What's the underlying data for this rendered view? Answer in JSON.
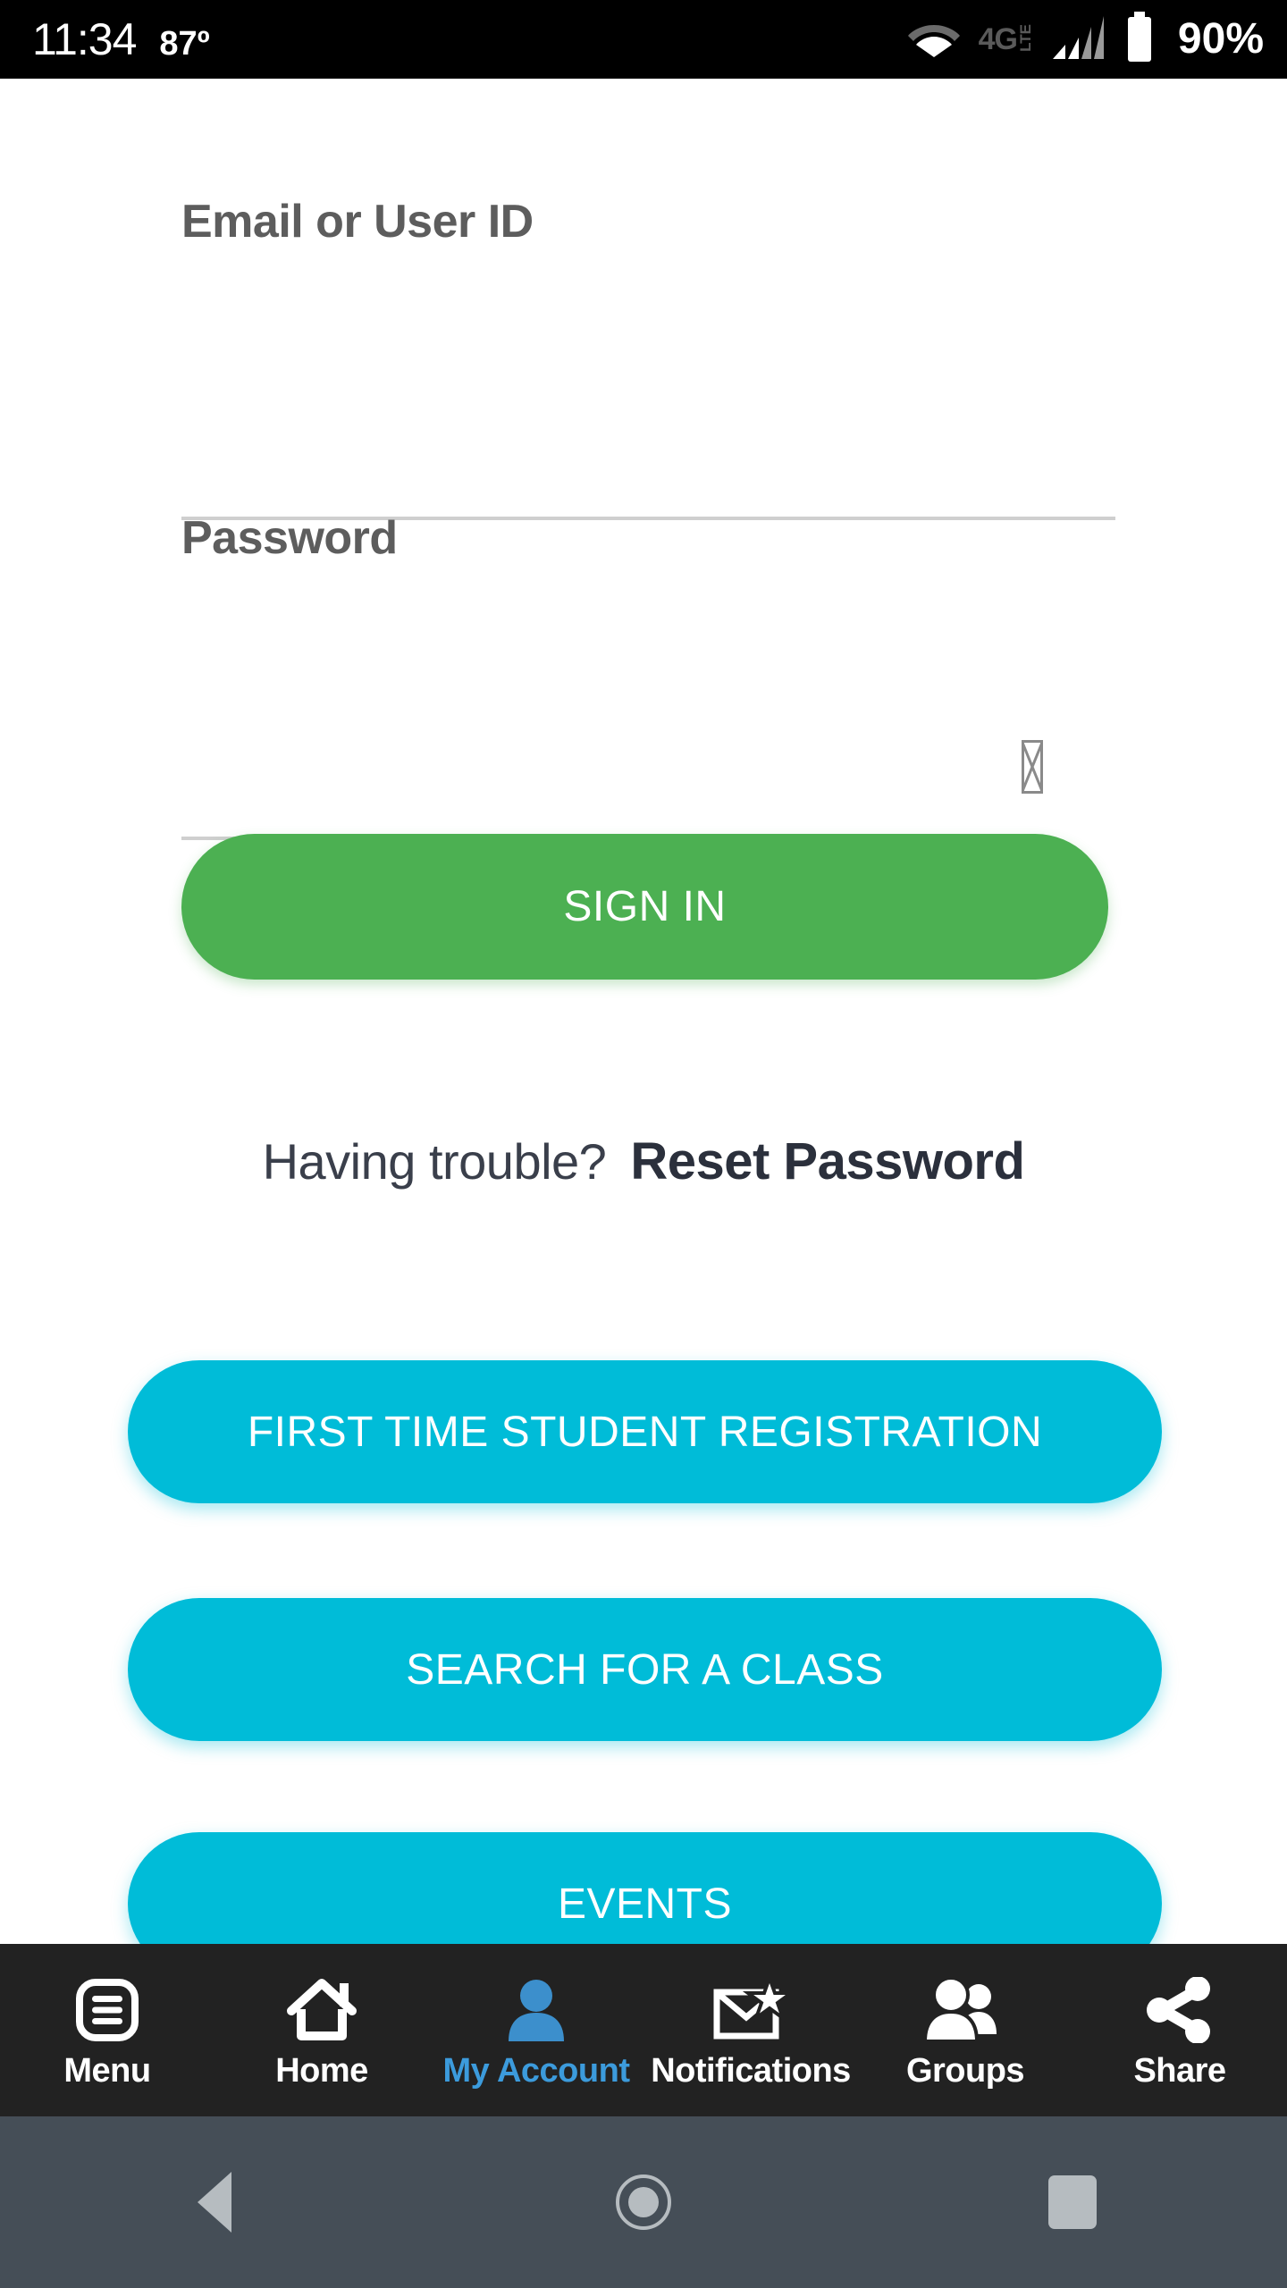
{
  "status_bar": {
    "time": "11:34",
    "temperature": "87º",
    "network_type": "4G",
    "network_sub": "LTE",
    "battery_percent": "90%",
    "wifi_icon": "wifi-icon",
    "signal_icon": "signal-bars-icon",
    "battery_icon": "battery-icon",
    "background_color": "#000000"
  },
  "form": {
    "email": {
      "label": "Email or User ID",
      "value": "",
      "placeholder": ""
    },
    "password": {
      "label": "Password",
      "value": "",
      "placeholder": "",
      "toggle_icon": "show-password-icon"
    }
  },
  "buttons": {
    "sign_in": "SIGN IN",
    "first_time_registration": "FIRST TIME STUDENT REGISTRATION",
    "search_for_class": "SEARCH FOR A CLASS",
    "events": "EVENTS"
  },
  "reset": {
    "prompt": "Having trouble?",
    "link": "Reset Password"
  },
  "colors": {
    "sign_in_green": "#4CB052",
    "cyan": "#00BCD8",
    "active_tab_blue": "#3C9BDC",
    "tab_bar_background": "#222222",
    "nav_bar_background": "#454E57",
    "field_underline": "#cfcfcf",
    "label_gray": "#5d5d5d"
  },
  "tab_bar": {
    "items": [
      {
        "label": "Menu",
        "icon": "menu-list-icon",
        "active": false
      },
      {
        "label": "Home",
        "icon": "home-icon",
        "active": false
      },
      {
        "label": "My Account",
        "icon": "person-icon",
        "active": true
      },
      {
        "label": "Notifications",
        "icon": "envelope-star-icon",
        "active": false
      },
      {
        "label": "Groups",
        "icon": "people-group-icon",
        "active": false
      },
      {
        "label": "Share",
        "icon": "share-nodes-icon",
        "active": false
      }
    ]
  },
  "android_nav": {
    "back": "back-triangle-icon",
    "home": "home-circle-icon",
    "recents": "recents-square-icon"
  }
}
